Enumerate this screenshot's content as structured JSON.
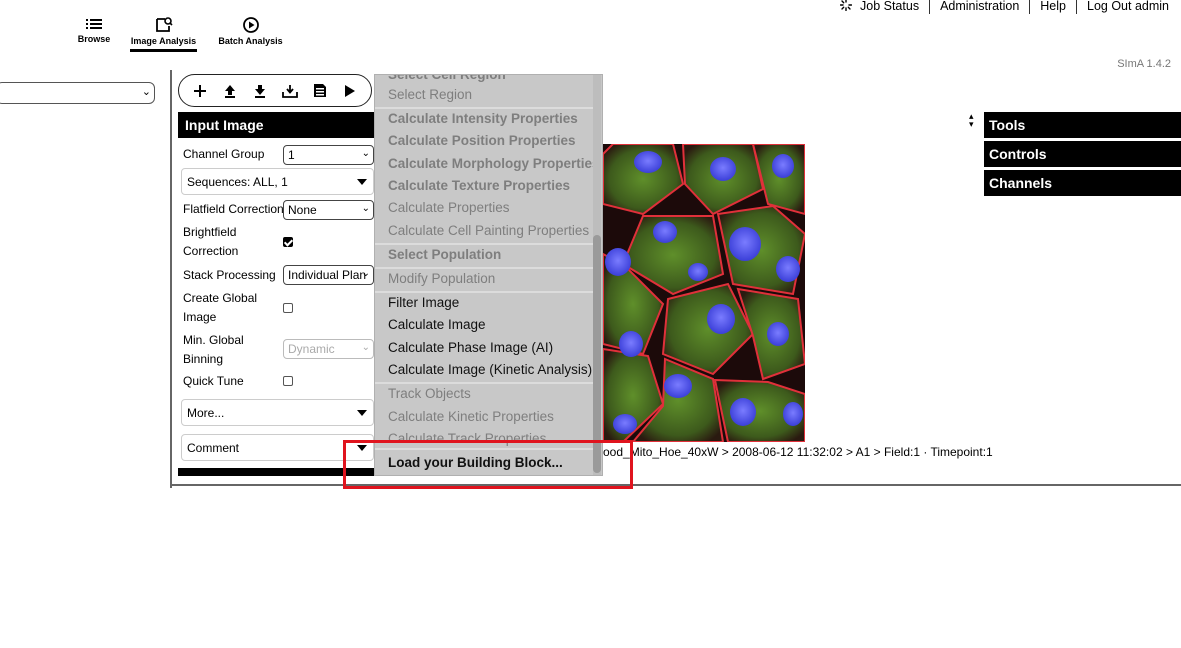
{
  "header": {
    "job_status": "Job Status",
    "administration": "Administration",
    "help": "Help",
    "logout": "Log Out admin",
    "version": "SImA 1.4.2"
  },
  "nav": {
    "browse": "Browse",
    "image_analysis": "Image Analysis",
    "batch_analysis": "Batch Analysis"
  },
  "panel": {
    "title": "Input Image",
    "channel_group_label": "Channel Group",
    "channel_group_value": "1",
    "sequences": "Sequences: ALL, 1",
    "flatfield_label": "Flatfield Correction",
    "flatfield_value": "None",
    "brightfield_label_1": "Brightfield",
    "brightfield_label_2": "Correction",
    "brightfield_checked": true,
    "stack_label": "Stack Processing",
    "stack_value": "Individual Plan",
    "global_image_label_1": "Create Global",
    "global_image_label_2": "Image",
    "min_binning_label_1": "Min. Global",
    "min_binning_label_2": "Binning",
    "min_binning_value": "Dynamic",
    "quick_tune_label": "Quick Tune",
    "more": "More...",
    "comment": "Comment"
  },
  "menu": {
    "items": [
      {
        "label": "Select Cell Region",
        "style": "grey bold"
      },
      {
        "label": "Select Region",
        "style": "grey"
      },
      {
        "label": "Calculate Intensity Properties",
        "style": "grey bold"
      },
      {
        "label": "Calculate Position Properties",
        "style": "grey bold"
      },
      {
        "label": "Calculate Morphology Properties",
        "style": "grey bold"
      },
      {
        "label": "Calculate Texture Properties",
        "style": "grey bold"
      },
      {
        "label": "Calculate Properties",
        "style": "grey"
      },
      {
        "label": "Calculate Cell Painting Properties",
        "style": "grey"
      },
      {
        "label": "Select Population",
        "style": "grey bold"
      },
      {
        "label": "Modify Population",
        "style": "grey"
      },
      {
        "label": "Filter Image",
        "style": "dark"
      },
      {
        "label": "Calculate Image",
        "style": "dark"
      },
      {
        "label": "Calculate Phase Image (AI)",
        "style": "dark"
      },
      {
        "label": "Calculate Image (Kinetic Analysis)",
        "style": "dark"
      },
      {
        "label": "Track Objects",
        "style": "grey"
      },
      {
        "label": "Calculate Kinetic Properties",
        "style": "grey"
      },
      {
        "label": "Calculate Track Properties",
        "style": "grey"
      },
      {
        "label": "Load your Building Block...",
        "style": "dark bold"
      }
    ]
  },
  "image_caption": "ood_Mito_Hoe_40xW > 2008-06-12 11:32:02 > A1 > Field:1 · Timepoint:1",
  "right_panels": {
    "tools": "Tools",
    "controls": "Controls",
    "channels": "Channels"
  },
  "colors": {
    "highlight": "#e0141e",
    "menu_bg": "#c8c8c8",
    "panel_header": "#000000"
  },
  "icons": [
    "spinner-icon",
    "list-icon",
    "image-analysis-icon",
    "play-circle-icon",
    "plus-icon",
    "upload-icon",
    "download-icon",
    "import-icon",
    "save-icon",
    "run-icon"
  ]
}
